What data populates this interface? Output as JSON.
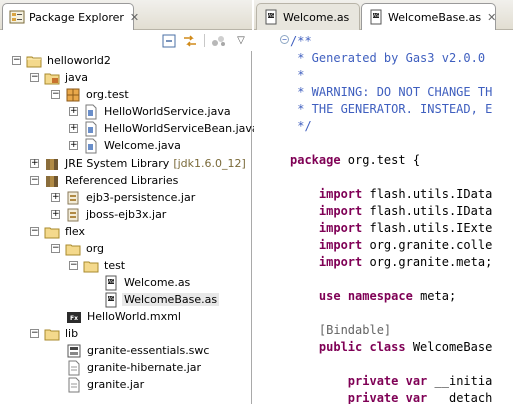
{
  "explorer": {
    "tab_label": "Package Explorer",
    "close_glyph": "✕",
    "toolbar": {
      "collapse_icon": "collapse-all-icon",
      "link_icon": "link-with-editor-icon",
      "view_menu_icon": "view-menu-icon",
      "menu_arrow": "▽"
    }
  },
  "tree": [
    {
      "label": "helloworld2",
      "icon": "project-icon",
      "expander": "−"
    },
    {
      "label": "java",
      "icon": "source-folder-icon",
      "expander": "−"
    },
    {
      "label": "org.test",
      "icon": "package-icon",
      "expander": "−"
    },
    {
      "label": "HelloWorldService.java",
      "icon": "java-file-icon",
      "expander": "+"
    },
    {
      "label": "HelloWorldServiceBean.java",
      "icon": "java-file-icon",
      "expander": "+"
    },
    {
      "label": "Welcome.java",
      "icon": "java-file-icon",
      "expander": "+"
    },
    {
      "label": "JRE System Library",
      "decoration": "[jdk1.6.0_12]",
      "icon": "library-icon",
      "expander": "+"
    },
    {
      "label": "Referenced Libraries",
      "icon": "library-icon",
      "expander": "−"
    },
    {
      "label": "ejb3-persistence.jar",
      "icon": "jar-icon",
      "expander": "+"
    },
    {
      "label": "jboss-ejb3x.jar",
      "icon": "jar-icon",
      "expander": "+"
    },
    {
      "label": "flex",
      "icon": "folder-icon",
      "expander": "−"
    },
    {
      "label": "org",
      "icon": "folder-icon",
      "expander": "−"
    },
    {
      "label": "test",
      "icon": "folder-icon",
      "expander": "−"
    },
    {
      "label": "Welcome.as",
      "icon": "as-file-icon",
      "expander": ""
    },
    {
      "label": "WelcomeBase.as",
      "icon": "as-file-icon",
      "expander": "",
      "selected": true
    },
    {
      "label": "HelloWorld.mxml",
      "icon": "mxml-file-icon",
      "expander": ""
    },
    {
      "label": "lib",
      "icon": "folder-icon",
      "expander": "−"
    },
    {
      "label": "granite-essentials.swc",
      "icon": "swc-file-icon",
      "expander": ""
    },
    {
      "label": "granite-hibernate.jar",
      "icon": "file-icon",
      "expander": ""
    },
    {
      "label": "granite.jar",
      "icon": "file-icon",
      "expander": ""
    }
  ],
  "editor": {
    "tabs": [
      {
        "label": "Welcome.as",
        "active": false
      },
      {
        "label": "WelcomeBase.as",
        "active": true
      }
    ],
    "close_glyph": "✕",
    "fold_glyph": "−",
    "code": [
      [
        {
          "t": "/**",
          "c": "cm"
        }
      ],
      [
        {
          "t": " * Generated by Gas3 v2.0.0",
          "c": "cm"
        }
      ],
      [
        {
          "t": " *",
          "c": "cm"
        }
      ],
      [
        {
          "t": " * WARNING: DO NOT CHANGE TH",
          "c": "cm"
        }
      ],
      [
        {
          "t": " * THE GENERATOR. INSTEAD, E",
          "c": "cm"
        }
      ],
      [
        {
          "t": " */",
          "c": "cm"
        }
      ],
      [],
      [
        {
          "t": "package",
          "c": "kw"
        },
        {
          "t": " org.test {",
          "c": ""
        }
      ],
      [],
      [
        {
          "t": "    import",
          "c": "kw"
        },
        {
          "t": " flash.utils.IData",
          "c": ""
        }
      ],
      [
        {
          "t": "    import",
          "c": "kw"
        },
        {
          "t": " flash.utils.IData",
          "c": ""
        }
      ],
      [
        {
          "t": "    import",
          "c": "kw"
        },
        {
          "t": " flash.utils.IExte",
          "c": ""
        }
      ],
      [
        {
          "t": "    import",
          "c": "kw"
        },
        {
          "t": " org.granite.colle",
          "c": ""
        }
      ],
      [
        {
          "t": "    import",
          "c": "kw"
        },
        {
          "t": " org.granite.meta;",
          "c": ""
        }
      ],
      [],
      [
        {
          "t": "    use",
          "c": "kw"
        },
        {
          "t": " ",
          "c": ""
        },
        {
          "t": "namespace",
          "c": "kw"
        },
        {
          "t": " meta;",
          "c": ""
        }
      ],
      [],
      [
        {
          "t": "    [Bindable]",
          "c": "md"
        }
      ],
      [
        {
          "t": "    public",
          "c": "kw"
        },
        {
          "t": " ",
          "c": ""
        },
        {
          "t": "class",
          "c": "kw"
        },
        {
          "t": " WelcomeBase",
          "c": ""
        }
      ],
      [],
      [
        {
          "t": "        private",
          "c": "kw"
        },
        {
          "t": " ",
          "c": ""
        },
        {
          "t": "var",
          "c": "kw"
        },
        {
          "t": " __initia",
          "c": ""
        }
      ],
      [
        {
          "t": "        private",
          "c": "kw"
        },
        {
          "t": " ",
          "c": ""
        },
        {
          "t": "var",
          "c": "kw"
        },
        {
          "t": " __detach",
          "c": ""
        }
      ]
    ]
  }
}
